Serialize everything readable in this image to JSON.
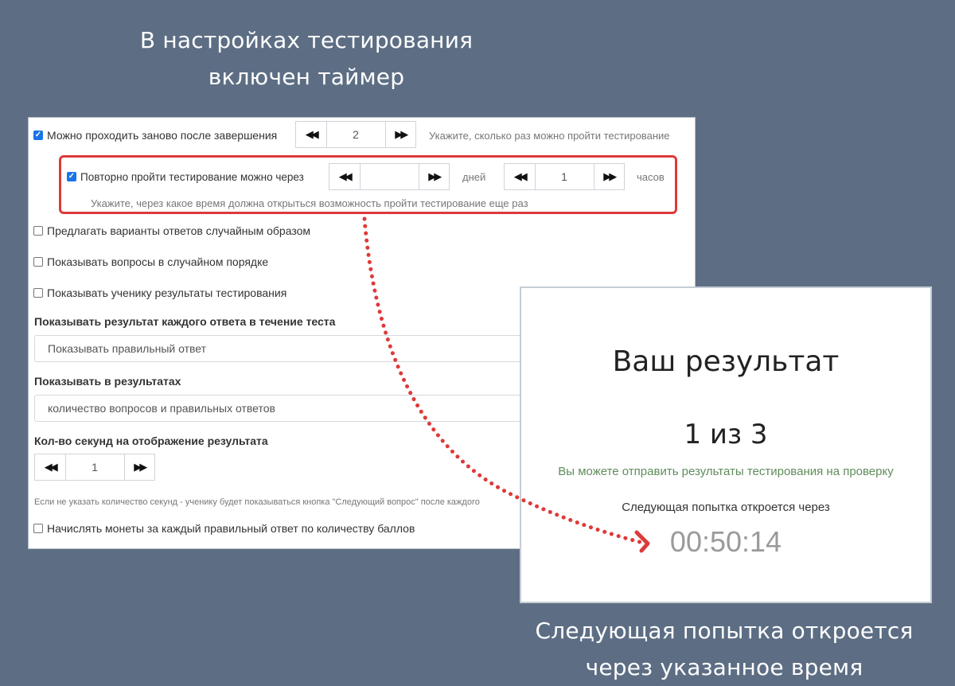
{
  "captions": {
    "top_line1": "В настройках тестирования",
    "top_line2": "включен таймер",
    "bottom_line1": "Следующая попытка откроется",
    "bottom_line2": "через указанное время"
  },
  "settings": {
    "retake": {
      "label": "Можно проходить заново после завершения",
      "checked": true,
      "value": "2",
      "hint": "Укажите, сколько раз можно пройти тестирование"
    },
    "retake_delay": {
      "label": "Повторно пройти тестирование можно через",
      "checked": true,
      "days_value": "",
      "days_unit": "дней",
      "hours_value": "1",
      "hours_unit": "часов",
      "hint": "Укажите, через какое время должна открыться возможность пройти тестирование еще раз"
    },
    "random_answers": {
      "label": "Предлагать варианты ответов случайным образом",
      "checked": false
    },
    "random_questions": {
      "label": "Показывать вопросы в случайном порядке",
      "checked": false
    },
    "show_results": {
      "label": "Показывать ученику результаты тестирования",
      "checked": false
    },
    "each_answer": {
      "heading": "Показывать результат каждого ответа в течение теста",
      "selected": "Показывать правильный ответ"
    },
    "in_results": {
      "heading": "Показывать в результатах",
      "selected": "количество вопросов и правильных ответов"
    },
    "seconds": {
      "heading": "Кол-во секунд на отображение результата",
      "value": "1",
      "note": "Если не указать количество секунд - ученику будет показываться кнопка \"Следующий вопрос\" после каждого"
    },
    "coins": {
      "label": "Начислять монеты за каждый правильный ответ по количеству баллов",
      "checked": false
    }
  },
  "result": {
    "title": "Ваш результат",
    "score": "1 из 3",
    "send_link": "Вы можете отправить результаты тестирования на проверку",
    "next_attempt": "Следующая попытка откроется через",
    "timer": "00:50:14"
  },
  "colors": {
    "background": "#5d6e84",
    "highlight": "#dd3a3a",
    "checkbox_checked": "#1a73e8",
    "link_green": "#5f8d5a"
  },
  "icons": {
    "stepper_prev": "double-left-arrow-icon",
    "stepper_next": "double-right-arrow-icon"
  }
}
